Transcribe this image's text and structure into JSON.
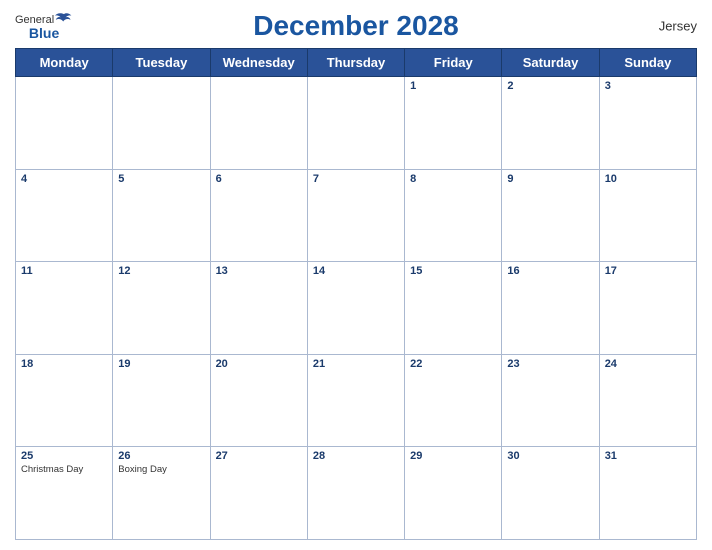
{
  "header": {
    "logo_general": "General",
    "logo_blue": "Blue",
    "title": "December 2028",
    "region": "Jersey"
  },
  "days_of_week": [
    "Monday",
    "Tuesday",
    "Wednesday",
    "Thursday",
    "Friday",
    "Saturday",
    "Sunday"
  ],
  "weeks": [
    [
      {
        "day": "",
        "holiday": ""
      },
      {
        "day": "",
        "holiday": ""
      },
      {
        "day": "",
        "holiday": ""
      },
      {
        "day": "",
        "holiday": ""
      },
      {
        "day": "1",
        "holiday": ""
      },
      {
        "day": "2",
        "holiday": ""
      },
      {
        "day": "3",
        "holiday": ""
      }
    ],
    [
      {
        "day": "4",
        "holiday": ""
      },
      {
        "day": "5",
        "holiday": ""
      },
      {
        "day": "6",
        "holiday": ""
      },
      {
        "day": "7",
        "holiday": ""
      },
      {
        "day": "8",
        "holiday": ""
      },
      {
        "day": "9",
        "holiday": ""
      },
      {
        "day": "10",
        "holiday": ""
      }
    ],
    [
      {
        "day": "11",
        "holiday": ""
      },
      {
        "day": "12",
        "holiday": ""
      },
      {
        "day": "13",
        "holiday": ""
      },
      {
        "day": "14",
        "holiday": ""
      },
      {
        "day": "15",
        "holiday": ""
      },
      {
        "day": "16",
        "holiday": ""
      },
      {
        "day": "17",
        "holiday": ""
      }
    ],
    [
      {
        "day": "18",
        "holiday": ""
      },
      {
        "day": "19",
        "holiday": ""
      },
      {
        "day": "20",
        "holiday": ""
      },
      {
        "day": "21",
        "holiday": ""
      },
      {
        "day": "22",
        "holiday": ""
      },
      {
        "day": "23",
        "holiday": ""
      },
      {
        "day": "24",
        "holiday": ""
      }
    ],
    [
      {
        "day": "25",
        "holiday": "Christmas Day"
      },
      {
        "day": "26",
        "holiday": "Boxing Day"
      },
      {
        "day": "27",
        "holiday": ""
      },
      {
        "day": "28",
        "holiday": ""
      },
      {
        "day": "29",
        "holiday": ""
      },
      {
        "day": "30",
        "holiday": ""
      },
      {
        "day": "31",
        "holiday": ""
      }
    ]
  ]
}
